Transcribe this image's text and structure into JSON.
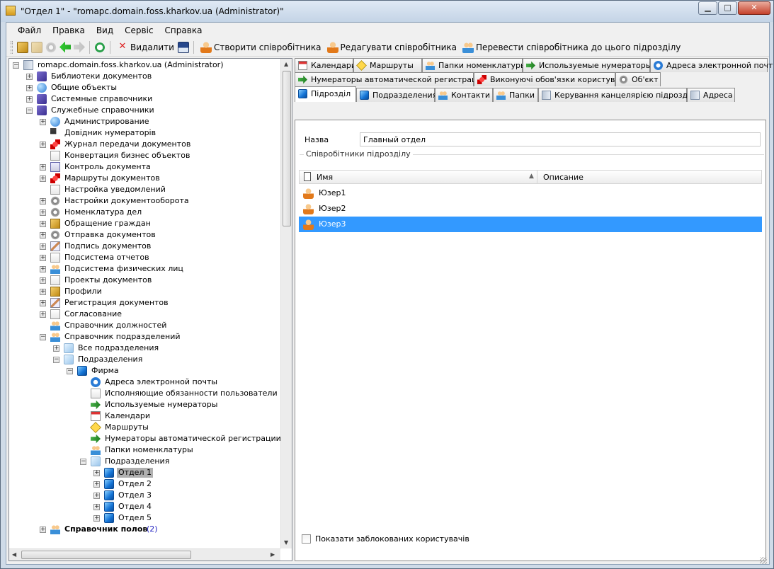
{
  "window": {
    "title": "\"Отдел 1\" - \"romapc.domain.foss.kharkov.ua (Administrator)\"",
    "min": "▁",
    "max": "□",
    "close": "✕"
  },
  "menu": [
    "Файл",
    "Правка",
    "Вид",
    "Сервіс",
    "Справка"
  ],
  "toolbar": {
    "delete": "Видалити",
    "create_employee": "Створити співробітника",
    "edit_employee": "Редагувати співробітника",
    "transfer_employee": "Перевести співробітника до цього підрозділу"
  },
  "tree": {
    "root": "romapc.domain.foss.kharkov.ua (Administrator)",
    "items": [
      {
        "label": "Библиотеки документов",
        "icon": "book-icon"
      },
      {
        "label": "Общие объекты",
        "icon": "globe-icon"
      },
      {
        "label": "Системные справочники",
        "icon": "book-icon"
      },
      {
        "label": "Служебные справочники",
        "icon": "book-icon"
      },
      {
        "label": "Администрирование",
        "icon": "globe-icon"
      },
      {
        "label": "Довідник нумераторів",
        "icon": "numerator-icon"
      },
      {
        "label": "Журнал передачи документов",
        "icon": "red-icon"
      },
      {
        "label": "Конвертация бизнес объектов",
        "icon": "doc-icon"
      },
      {
        "label": "Контроль документа",
        "icon": "ok-icon"
      },
      {
        "label": "Маршруты документов",
        "icon": "red-icon"
      },
      {
        "label": "Настройка уведомлений",
        "icon": "doc-icon"
      },
      {
        "label": "Настройки документооборота",
        "icon": "gear-icon"
      },
      {
        "label": "Номенклатура дел",
        "icon": "gear-icon"
      },
      {
        "label": "Обращение граждан",
        "icon": "box-icon"
      },
      {
        "label": "Отправка документов",
        "icon": "gear-icon"
      },
      {
        "label": "Подпись документов",
        "icon": "pen-icon"
      },
      {
        "label": "Подсистема отчетов",
        "icon": "doc-icon"
      },
      {
        "label": "Подсистема физических лиц",
        "icon": "users-icon"
      },
      {
        "label": "Проекты документов",
        "icon": "doc-icon"
      },
      {
        "label": "Профили",
        "icon": "box-icon"
      },
      {
        "label": "Регистрация документов",
        "icon": "pen-icon"
      },
      {
        "label": "Согласование",
        "icon": "doc-icon"
      },
      {
        "label": "Справочник должностей",
        "icon": "users-icon"
      },
      {
        "label": "Справочник подразделений",
        "icon": "users-icon"
      },
      {
        "label": "Все подразделения",
        "icon": "cube-icon"
      },
      {
        "label": "Подразделения",
        "icon": "cube-icon"
      },
      {
        "label": "Фирма",
        "icon": "cube-icon"
      },
      {
        "label": "Адреса электронной почты",
        "icon": "mail-icon"
      },
      {
        "label": "Исполняющие обязанности пользователи",
        "icon": "doc-icon"
      },
      {
        "label": "Используемые нумераторы",
        "icon": "arrow-icon"
      },
      {
        "label": "Календари",
        "icon": "calendar-icon"
      },
      {
        "label": "Маршруты",
        "icon": "route-icon"
      },
      {
        "label": "Нумераторы автоматической регистрации",
        "icon": "arrow-icon"
      },
      {
        "label": "Папки номенклатуры",
        "icon": "users-icon"
      },
      {
        "label": "Подразделения",
        "icon": "cube-icon"
      },
      {
        "label": "Отдел 1",
        "icon": "cube-icon"
      },
      {
        "label": "Отдел 2",
        "icon": "cube-icon"
      },
      {
        "label": "Отдел 3",
        "icon": "cube-icon"
      },
      {
        "label": "Отдел 4",
        "icon": "cube-icon"
      },
      {
        "label": "Отдел 5",
        "icon": "cube-icon"
      },
      {
        "label": "Справочник полов",
        "icon": "users-icon",
        "count": "(2)"
      }
    ]
  },
  "tabs": {
    "row1": [
      "Календари",
      "Маршруты",
      "Папки номенклатуры",
      "Используемые нумераторы",
      "Адреса электронной почты"
    ],
    "row2": [
      "Нумераторы автоматической регистрации",
      "Виконуючі обов'язки користувачі",
      "Об'єкт"
    ],
    "row3": [
      "Підрозділ",
      "Подразделения",
      "Контакти",
      "Папки",
      "Керування канцелярією підрозділу",
      "Адреса"
    ]
  },
  "form": {
    "name_label": "Назва",
    "name_value": "Главный отдел",
    "group_title": "Співробітники підрозділу",
    "col_name": "Имя",
    "col_desc": "Описание",
    "employees": [
      "Юзер1",
      "Юзер2",
      "Юзер3"
    ],
    "show_blocked": "Показати заблокованих користувачів"
  }
}
